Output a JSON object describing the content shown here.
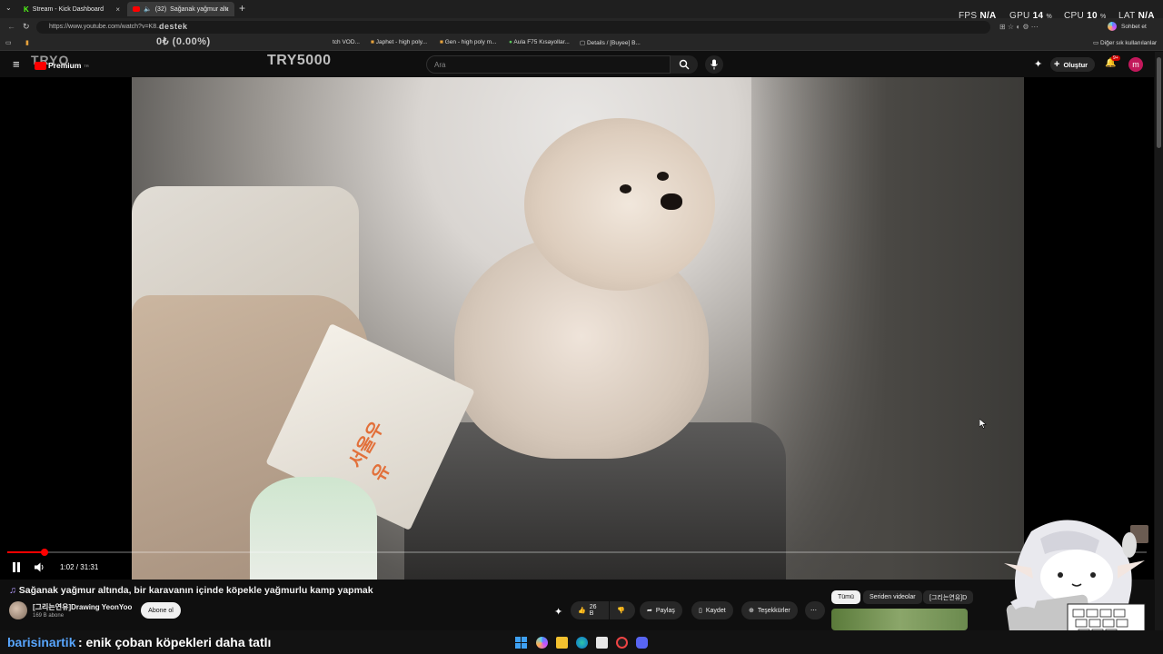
{
  "browser": {
    "tabs": [
      {
        "label": "Stream - Kick Dashboard"
      },
      {
        "label": "(32)",
        "label2": "Sağanak yağmur altı"
      }
    ],
    "url": "https://www.youtube.com/watch?v=K8...",
    "bookmarks": [
      "tch VOD...",
      "Japhet - high poly...",
      "Gen - high poly m...",
      "Aula F75 Kısayollar...",
      "Details / [Buyee] B..."
    ],
    "other_bookmarks": "Diğer sık kullanılanlar",
    "chat_button": "Sohbet et"
  },
  "stats": {
    "fps_label": "FPS",
    "fps_value": "N/A",
    "gpu_label": "GPU",
    "gpu_value": "14",
    "cpu_label": "CPU",
    "cpu_value": "10",
    "lat_label": "LAT",
    "lat_value": "N/A"
  },
  "overlay": {
    "donate_label": "destek",
    "donate_progress": "0₺ (0.00%)",
    "logo_top": "TRYO",
    "goal": "TRY5000"
  },
  "youtube": {
    "logo": "Premium",
    "logo_sup": "TR",
    "search_placeholder": "Ara",
    "create_label": "Oluştur",
    "notif_count": "9+",
    "avatar_letter": "m"
  },
  "player": {
    "current_time": "1:02",
    "duration": "31:31",
    "progress": 0.0328
  },
  "video": {
    "title": "Sağanak yağmur altında, bir karavanın içinde köpekle yağmurlu kamp yapmak",
    "channel": "[그리는연유]Drawing YeonYoo",
    "subscribers": "169 B abone",
    "subscribe_label": "Abone ol",
    "likes": "26 B",
    "share_label": "Paylaş",
    "save_label": "Kaydet",
    "thanks_label": "Teşekkürler",
    "scene_text": "서울우유"
  },
  "related_chips": [
    "Tümü",
    "Seriden videolar",
    "[그리는연유]D"
  ],
  "chat": {
    "user": "barisinartik",
    "message": ": enik çoban köpekleri daha tatlı"
  },
  "colors": {
    "accent": "#ff0000",
    "chat_user": "#58a6ff",
    "avatar_bg": "#c2185b"
  }
}
